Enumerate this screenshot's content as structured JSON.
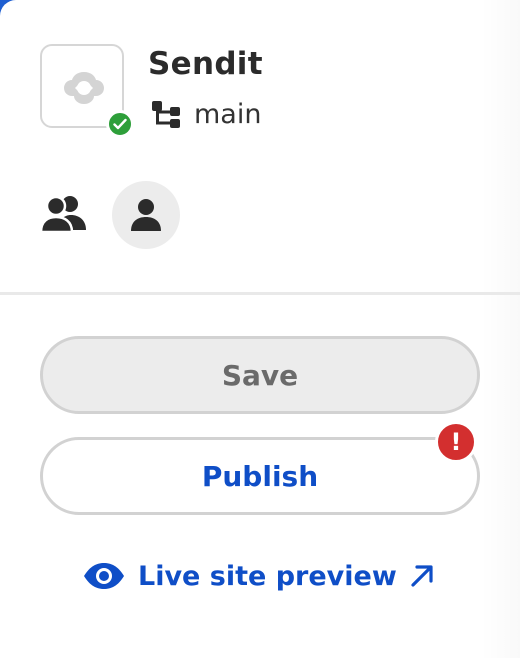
{
  "project": {
    "name": "Sendit",
    "branch": "main",
    "status": "ok"
  },
  "actions": {
    "save_label": "Save",
    "publish_label": "Publish",
    "publish_alert": "!"
  },
  "preview": {
    "label": "Live site preview"
  },
  "icons": {
    "project_logo": "cloud-logo-icon",
    "branch": "branch-icon",
    "team": "team-icon",
    "user": "user-icon",
    "eye": "eye-icon",
    "external": "arrow-up-right-icon"
  },
  "colors": {
    "accent": "#0f4ec7",
    "success": "#2e9f3a",
    "danger": "#d32f2f"
  }
}
